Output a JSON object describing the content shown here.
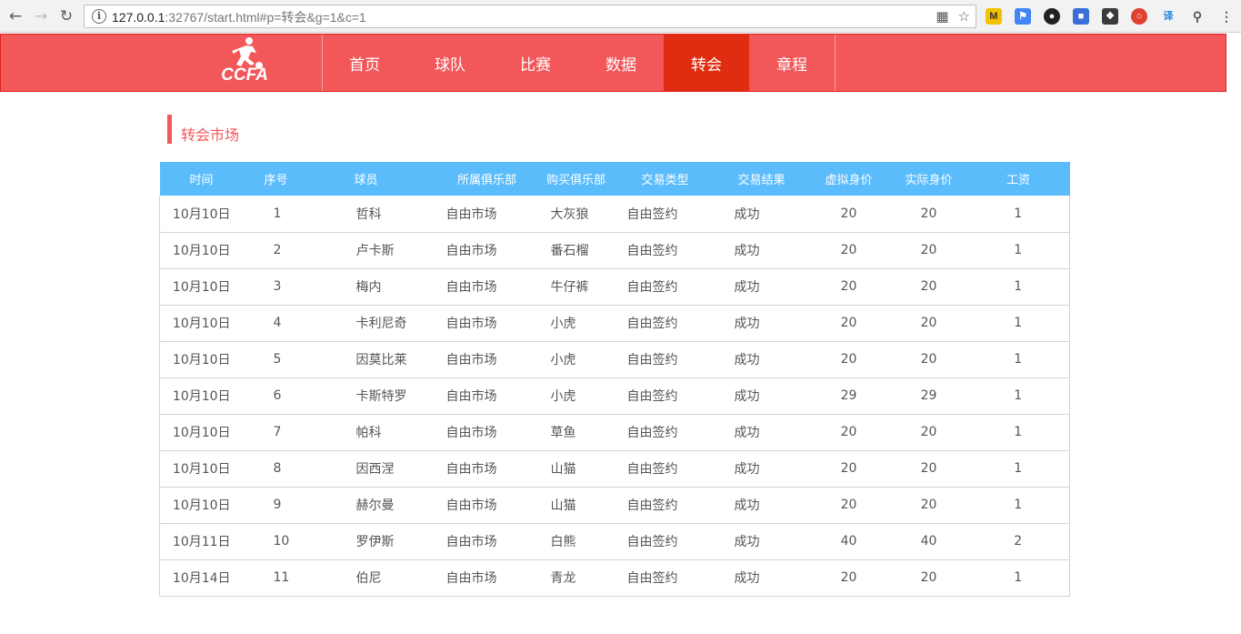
{
  "browser": {
    "url_host": "127.0.0.1",
    "url_rest": ":32767/start.html#p=转会&g=1&c=1"
  },
  "site": {
    "logo_text": "CCFA",
    "nav": [
      {
        "label": "首页",
        "active": false
      },
      {
        "label": "球队",
        "active": false
      },
      {
        "label": "比赛",
        "active": false
      },
      {
        "label": "数据",
        "active": false
      },
      {
        "label": "转会",
        "active": true
      },
      {
        "label": "章程",
        "active": false
      }
    ],
    "colors": {
      "header": "#f2575a",
      "active_nav": "#e02c10",
      "table_header": "#5bbcfc"
    }
  },
  "section": {
    "title": "转会市场"
  },
  "table": {
    "headers": [
      "时间",
      "序号",
      "球员",
      "所属俱乐部",
      "购买俱乐部",
      "交易类型",
      "交易结果",
      "虚拟身价",
      "实际身价",
      "工资"
    ],
    "rows": [
      [
        "10月10日",
        "1",
        "哲科",
        "自由市场",
        "大灰狼",
        "自由签约",
        "成功",
        "20",
        "20",
        "1"
      ],
      [
        "10月10日",
        "2",
        "卢卡斯",
        "自由市场",
        "番石榴",
        "自由签约",
        "成功",
        "20",
        "20",
        "1"
      ],
      [
        "10月10日",
        "3",
        "梅内",
        "自由市场",
        "牛仔裤",
        "自由签约",
        "成功",
        "20",
        "20",
        "1"
      ],
      [
        "10月10日",
        "4",
        "卡利尼奇",
        "自由市场",
        "小虎",
        "自由签约",
        "成功",
        "20",
        "20",
        "1"
      ],
      [
        "10月10日",
        "5",
        "因莫比莱",
        "自由市场",
        "小虎",
        "自由签约",
        "成功",
        "20",
        "20",
        "1"
      ],
      [
        "10月10日",
        "6",
        "卡斯特罗",
        "自由市场",
        "小虎",
        "自由签约",
        "成功",
        "29",
        "29",
        "1"
      ],
      [
        "10月10日",
        "7",
        "帕科",
        "自由市场",
        "草鱼",
        "自由签约",
        "成功",
        "20",
        "20",
        "1"
      ],
      [
        "10月10日",
        "8",
        "因西涅",
        "自由市场",
        "山猫",
        "自由签约",
        "成功",
        "20",
        "20",
        "1"
      ],
      [
        "10月10日",
        "9",
        "赫尔曼",
        "自由市场",
        "山猫",
        "自由签约",
        "成功",
        "20",
        "20",
        "1"
      ],
      [
        "10月11日",
        "10",
        "罗伊斯",
        "自由市场",
        "白熊",
        "自由签约",
        "成功",
        "40",
        "40",
        "2"
      ],
      [
        "10月14日",
        "11",
        "伯尼",
        "自由市场",
        "青龙",
        "自由签约",
        "成功",
        "20",
        "20",
        "1"
      ]
    ]
  }
}
